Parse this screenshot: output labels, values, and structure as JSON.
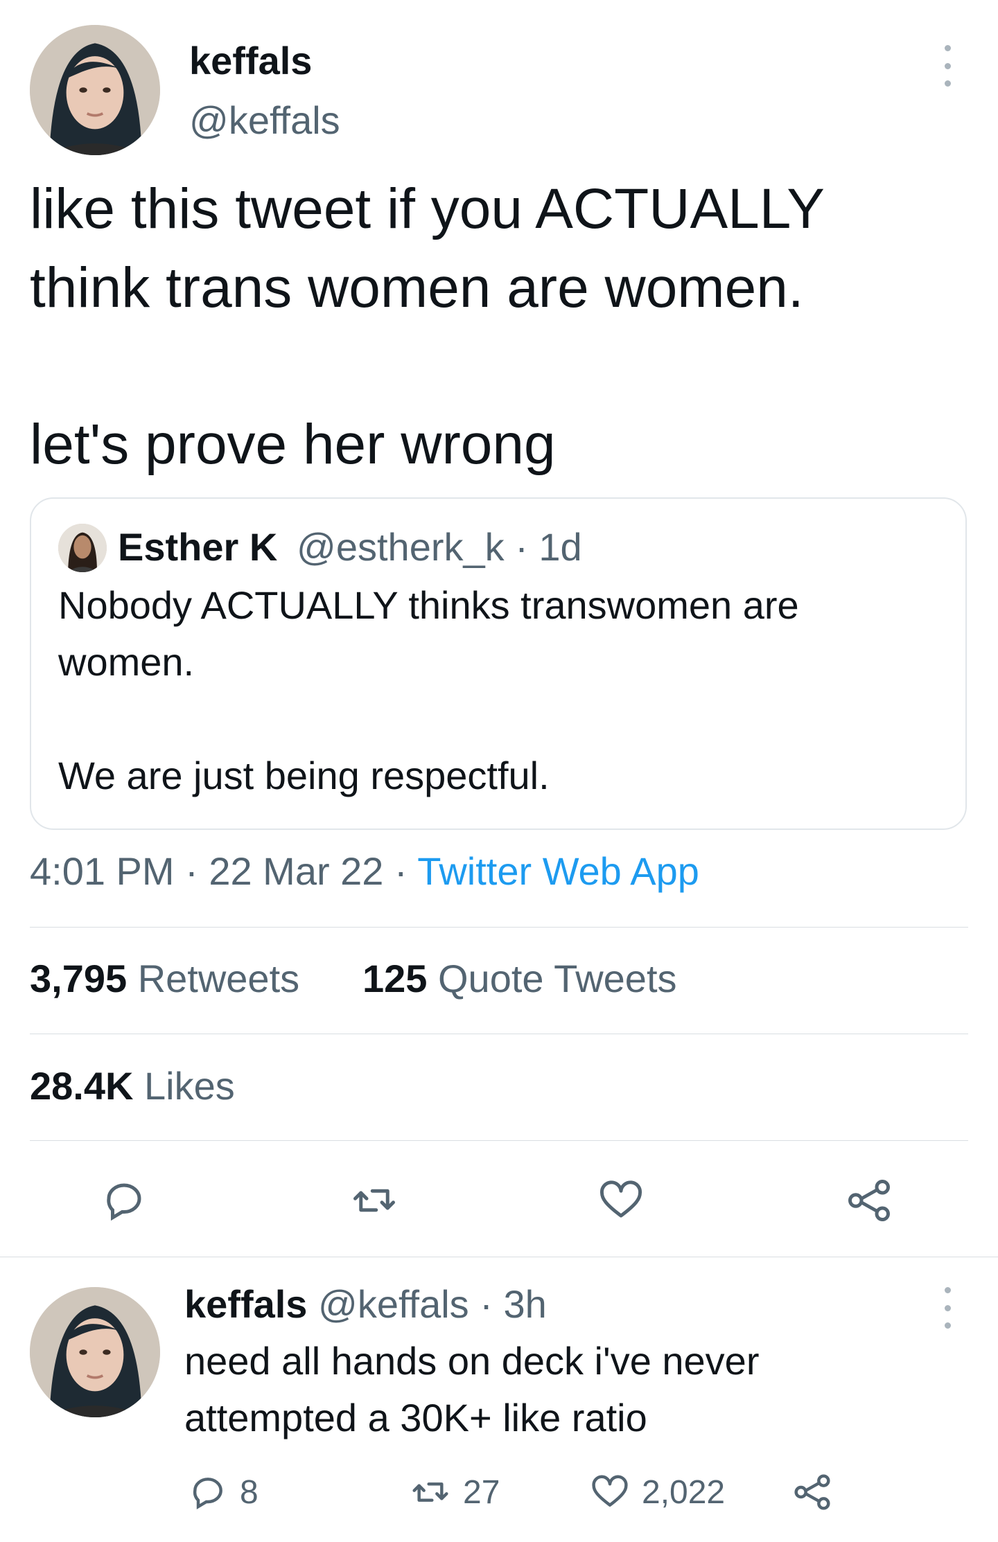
{
  "main_tweet": {
    "display_name": "keffals",
    "handle": "@keffals",
    "text_line1": "like this tweet if you ACTUALLY",
    "text_line2": "think trans women are women.",
    "text_line3": "let's prove her wrong",
    "timestamp": "4:01 PM · 22 Mar 22 · ",
    "source": "Twitter Web App",
    "stats": {
      "retweets_count": "3,795",
      "retweets_label": "Retweets",
      "quotes_count": "125",
      "quotes_label": "Quote Tweets",
      "likes_count": "28.4K",
      "likes_label": "Likes"
    },
    "action_icons": [
      "reply-icon",
      "retweet-icon",
      "like-icon",
      "share-icon"
    ]
  },
  "quoted_tweet": {
    "display_name": "Esther K",
    "handle_time": "@estherk_k · 1d",
    "text_line1": "Nobody ACTUALLY thinks transwomen are",
    "text_line2": "women.",
    "text_line3": "We are just being respectful."
  },
  "reply_tweet": {
    "display_name": "keffals",
    "handle_time": "@keffals · 3h",
    "text_line1": "need all hands on deck i've never",
    "text_line2": "attempted a 30K+ like ratio",
    "reply_count": "8",
    "retweet_count": "27",
    "like_count": "2,022"
  },
  "colors": {
    "text": "#0f1419",
    "muted": "#536471",
    "link": "#1d9bf0",
    "divider": "#d9dee2"
  }
}
